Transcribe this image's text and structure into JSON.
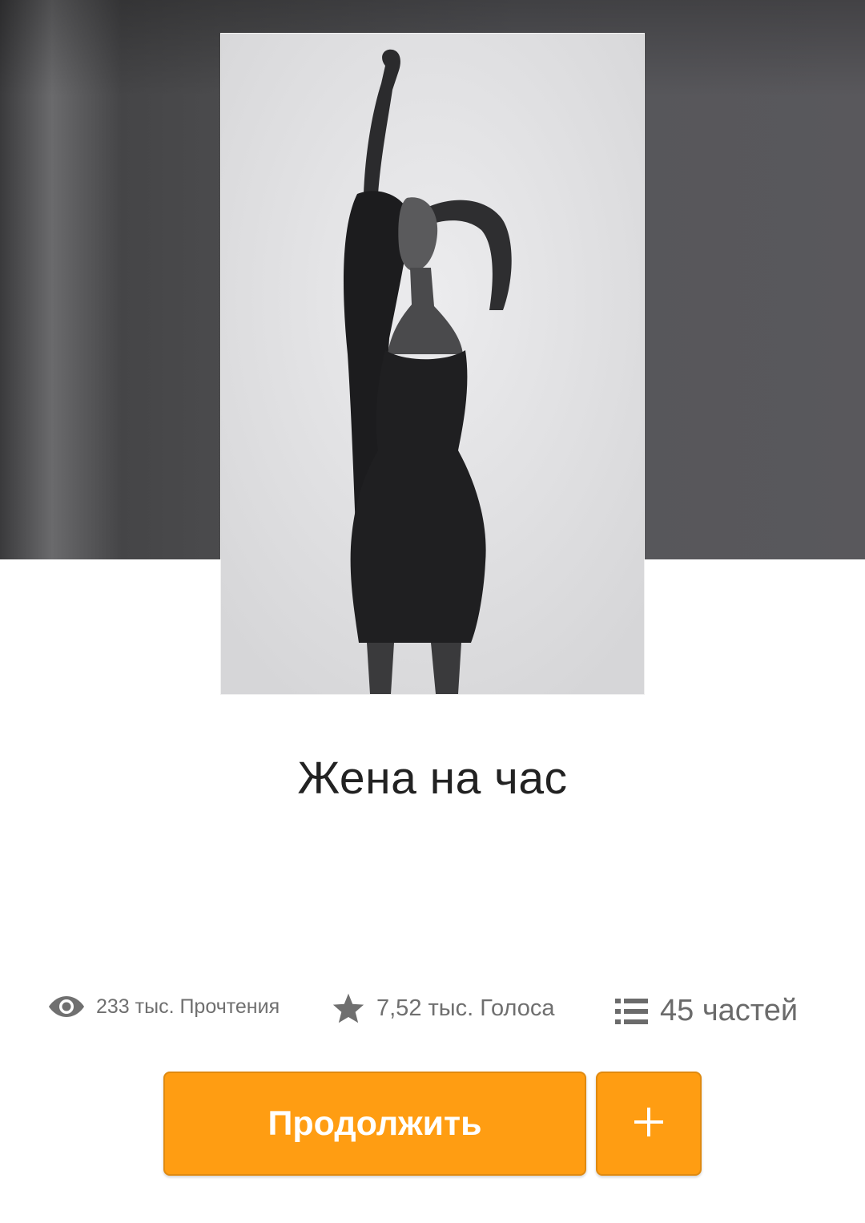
{
  "story": {
    "title": "Жена на час"
  },
  "stats": {
    "reads": "233 тыс. Прочтения",
    "votes": "7,52 тыс. Голоса",
    "parts": "45 частей"
  },
  "actions": {
    "continue_label": "Продолжить",
    "add_label": "+"
  },
  "icons": {
    "reads": "eye-icon",
    "votes": "star-icon",
    "parts": "list-icon",
    "add": "plus-icon"
  },
  "colors": {
    "accent": "#ff9d12",
    "hero_background": "#4f4f52",
    "text_primary": "#222222",
    "text_secondary": "#6f6f6f"
  }
}
